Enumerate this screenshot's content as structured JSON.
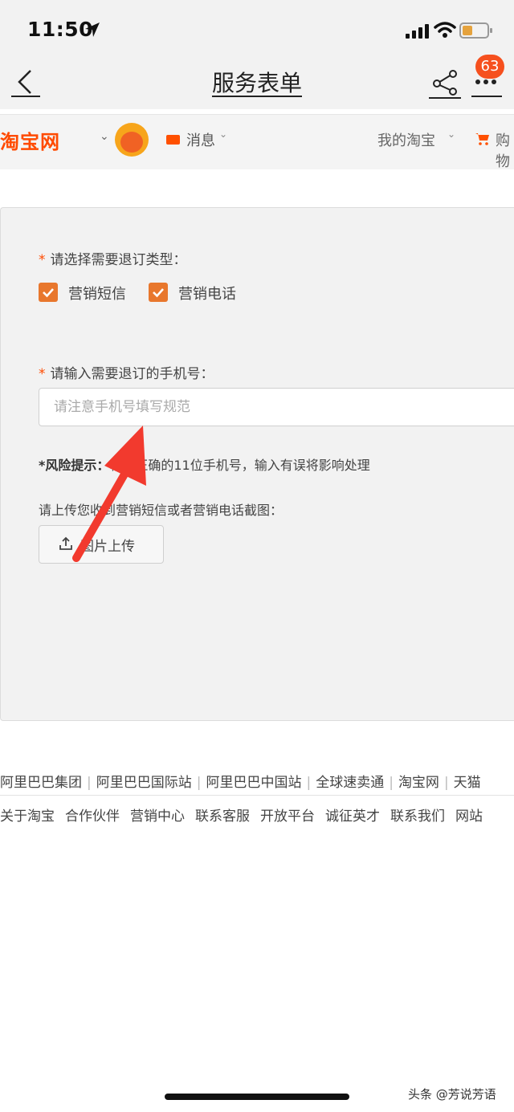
{
  "status_bar": {
    "time": "11:50",
    "icons": [
      "location-arrow-icon",
      "signal-icon",
      "wifi-icon",
      "battery-icon"
    ]
  },
  "title_bar": {
    "title": "服务表单",
    "badge_count": "63",
    "icons": [
      "back-chevron-icon",
      "share-icon",
      "more-dots-icon"
    ]
  },
  "taobao_header": {
    "logo": "淘宝网",
    "messages": "消息",
    "my_taobao": "我的淘宝",
    "cart": "购物",
    "brand_color": "#ff4a00"
  },
  "form": {
    "unsubscribe_type_label": "请选择需要退订类型：",
    "options": [
      {
        "label": "营销短信",
        "checked": true
      },
      {
        "label": "营销电话",
        "checked": true
      }
    ],
    "phone_label": "请输入需要退订的手机号：",
    "phone_placeholder": "请注意手机号填写规范",
    "phone_value": "",
    "risk_title": "*风险提示：",
    "risk_text": "输入正确的11位手机号，输入有误将影响处理",
    "upload_label": "请上传您收到营销短信或者营销电话截图：",
    "upload_button": "图片上传",
    "checkbox_color": "#e8772d"
  },
  "footer": {
    "row1": [
      "阿里巴巴集团",
      "阿里巴巴国际站",
      "阿里巴巴中国站",
      "全球速卖通",
      "淘宝网",
      "天猫"
    ],
    "row2": [
      "关于淘宝",
      "合作伙伴",
      "营销中心",
      "联系客服",
      "开放平台",
      "诚征英才",
      "联系我们",
      "网站"
    ]
  },
  "watermark": "头条 @芳说芳语"
}
